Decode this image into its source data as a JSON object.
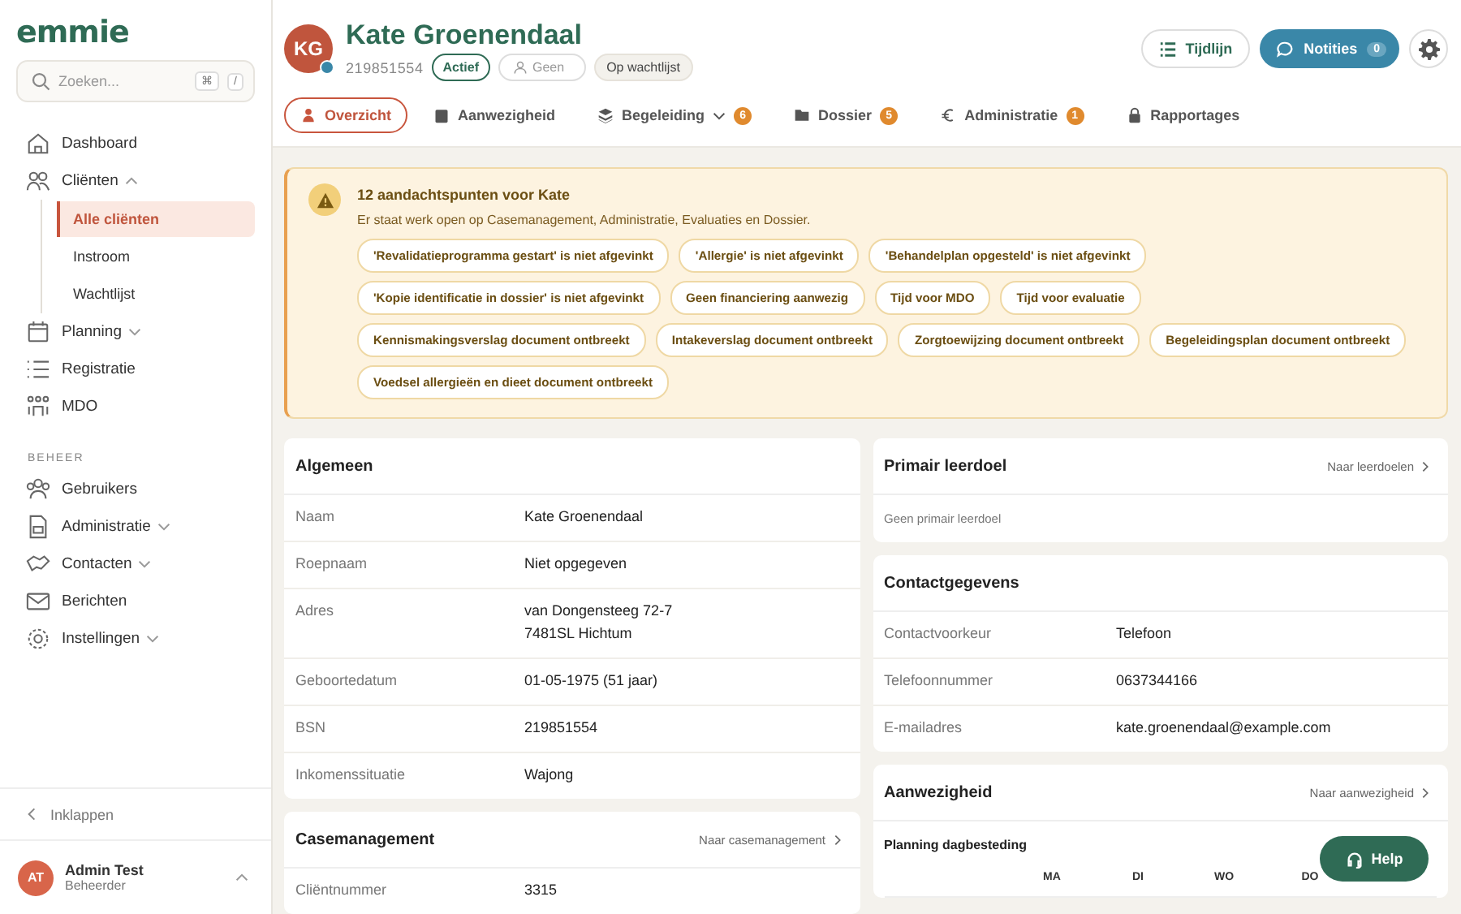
{
  "sidebar": {
    "logo": "emmie",
    "search": {
      "placeholder": "Zoeken...",
      "keys": [
        "⌘",
        "/"
      ]
    },
    "items": [
      {
        "kind": "item",
        "label": "Dashboard",
        "selected": false
      },
      {
        "kind": "item",
        "label": "Cliënten",
        "selected": false,
        "expanded": true,
        "children": [
          {
            "label": "Alle cliënten",
            "selected": true
          },
          {
            "label": "Instroom",
            "selected": false
          },
          {
            "label": "Wachtlijst",
            "selected": false
          }
        ]
      },
      {
        "kind": "item",
        "label": "Planning",
        "selected": false,
        "expanded": false
      },
      {
        "kind": "item",
        "label": "Registratie",
        "selected": false
      },
      {
        "kind": "item",
        "label": "MDO",
        "selected": false
      },
      {
        "kind": "section",
        "label": "BEHEER"
      },
      {
        "kind": "item",
        "label": "Gebruikers",
        "selected": false
      },
      {
        "kind": "item",
        "label": "Administratie",
        "selected": false,
        "expanded": false
      },
      {
        "kind": "item",
        "label": "Contacten",
        "selected": false,
        "expanded": false
      },
      {
        "kind": "item",
        "label": "Berichten",
        "selected": false
      },
      {
        "kind": "item",
        "label": "Instellingen",
        "selected": false,
        "expanded": false
      }
    ],
    "collapse": "Inklappen",
    "user": {
      "initials": "AT",
      "name": "Admin Test",
      "role": "Beheerder"
    }
  },
  "client": {
    "initials": "KG",
    "name": "Kate Groenendaal",
    "number": "219851554",
    "status": "Actief",
    "mentor": "Geen",
    "waitlist": "Op wachtlijst"
  },
  "actions": {
    "timeline": "Tijdlijn",
    "notes": "Notities",
    "notes_count": "0"
  },
  "tabs": [
    {
      "label": "Overzicht",
      "selected": true
    },
    {
      "label": "Aanwezigheid",
      "selected": false
    },
    {
      "label": "Begeleiding",
      "selected": false,
      "dropdown": true,
      "badge": "6"
    },
    {
      "label": "Dossier",
      "selected": false,
      "badge": "5"
    },
    {
      "label": "Administratie",
      "selected": false,
      "badge": "1"
    },
    {
      "label": "Rapportages",
      "selected": false
    }
  ],
  "alert": {
    "title": "12 aandachtspunten voor Kate",
    "text": "Er staat werk open op Casemanagement, Administratie, Evaluaties en Dossier.",
    "chips": [
      "'Revalidatieprogramma gestart' is niet afgevinkt",
      "'Allergie' is niet afgevinkt",
      "'Behandelplan opgesteld' is niet afgevinkt",
      "'Kopie identificatie in dossier' is niet afgevinkt",
      "Geen financiering aanwezig",
      "Tijd voor MDO",
      "Tijd voor evaluatie",
      "Kennismakingsverslag document ontbreekt",
      "Intakeverslag document ontbreekt",
      "Zorgtoewijzing document ontbreekt",
      "Begeleidingsplan document ontbreekt",
      "Voedsel allergieën en dieet document ontbreekt"
    ]
  },
  "left_cards": [
    {
      "title": "Algemeen",
      "rows": [
        {
          "label": "Naam",
          "value": [
            "Kate Groenendaal"
          ]
        },
        {
          "label": "Roepnaam",
          "value": [
            "Niet opgegeven"
          ]
        },
        {
          "label": "Adres",
          "value": [
            "van Dongensteeg 72-7",
            "7481SL Hichtum"
          ]
        },
        {
          "label": "Geboortedatum",
          "value": [
            "01-05-1975 (51 jaar)"
          ]
        },
        {
          "label": "BSN",
          "value": [
            "219851554"
          ]
        },
        {
          "label": "Inkomenssituatie",
          "value": [
            "Wajong"
          ]
        }
      ]
    },
    {
      "title": "Casemanagement",
      "link": "Naar casemanagement",
      "rows": [
        {
          "label": "Cliëntnummer",
          "value": [
            "3315"
          ]
        }
      ]
    }
  ],
  "right_cards": [
    {
      "title": "Primair leerdoel",
      "link": "Naar leerdoelen",
      "empty": "Geen primair leerdoel"
    },
    {
      "title": "Contactgegevens",
      "rows": [
        {
          "label": "Contactvoorkeur",
          "value": [
            "Telefoon"
          ]
        },
        {
          "label": "Telefoonnummer",
          "value": [
            "0637344166"
          ]
        },
        {
          "label": "E-mailadres",
          "value": [
            "kate.groenendaal@example.com"
          ]
        }
      ]
    },
    {
      "title": "Aanwezigheid",
      "link": "Naar aanwezigheid",
      "subtitle": "Planning dagbesteding",
      "days": [
        "MA",
        "DI",
        "WO",
        "DO"
      ]
    }
  ],
  "help": "Help"
}
